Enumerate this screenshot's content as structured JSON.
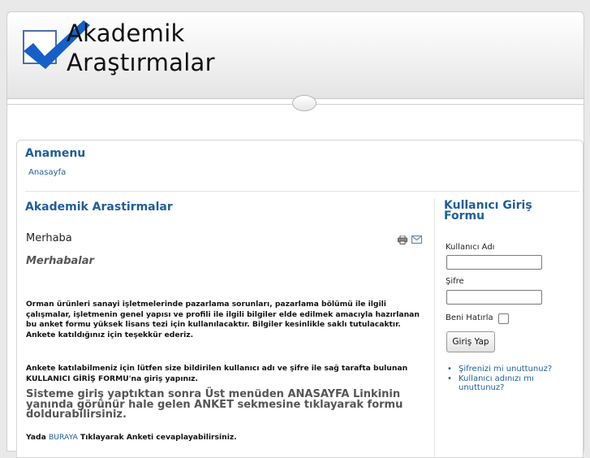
{
  "site": {
    "logo_line1": "Akademik",
    "logo_line2": "Araştırmalar"
  },
  "menu": {
    "title": "Anamenu",
    "items": [
      {
        "label": "Anasayfa"
      }
    ]
  },
  "main": {
    "title": "Akademik Arastirmalar",
    "article_title": "Merhaba",
    "greeting": "Merhabalar",
    "para1": "Orman ürünleri sanayi işletmelerinde pazarlama sorunları, pazarlama bölümü ile ilgili çalışmalar, işletmenin genel yapısı ve profili ile ilgili bilgiler elde edilmek amacıyla hazırlanan bu anket formu yüksek lisans tezi için kullanılacaktır. Bilgiler kesinlikle saklı tutulacaktır. Ankete katıldığınız için teşekkür ederiz.",
    "para2": "Ankete katılabilmeniz için lütfen size bildirilen kullanıcı adı ve şifre ile sağ tarafta bulunan KULLANICI GİRİŞ FORMU'na giriş yapınız.",
    "para_big": "Sisteme giriş yaptıktan sonra Üst menüden ANASAYFA Linkinin yanında görünür hale gelen ANKET sekmesine tıklayarak formu doldurabilirsiniz.",
    "para3_prefix": "Yada",
    "para3_link": "BURAYA",
    "para3_suffix": "Tıklayarak Anketi cevaplayabilirsiniz."
  },
  "login": {
    "title": "Kullanıcı Giriş Formu",
    "username_label": "Kullanıcı Adı",
    "username_value": "",
    "password_label": "Şifre",
    "password_value": "",
    "remember_label": "Beni Hatırla",
    "submit_label": "Giriş Yap",
    "links": [
      {
        "label": "Şifrenizi mi unuttunuz?"
      },
      {
        "label": "Kullanıcı adınızı mı unuttunuz?"
      }
    ]
  },
  "icons": {
    "logo": "checkmark-logo-icon",
    "print": "print-icon",
    "email": "email-icon"
  },
  "colors": {
    "link": "#1f5d9b",
    "logo_blue": "#1560c8"
  }
}
